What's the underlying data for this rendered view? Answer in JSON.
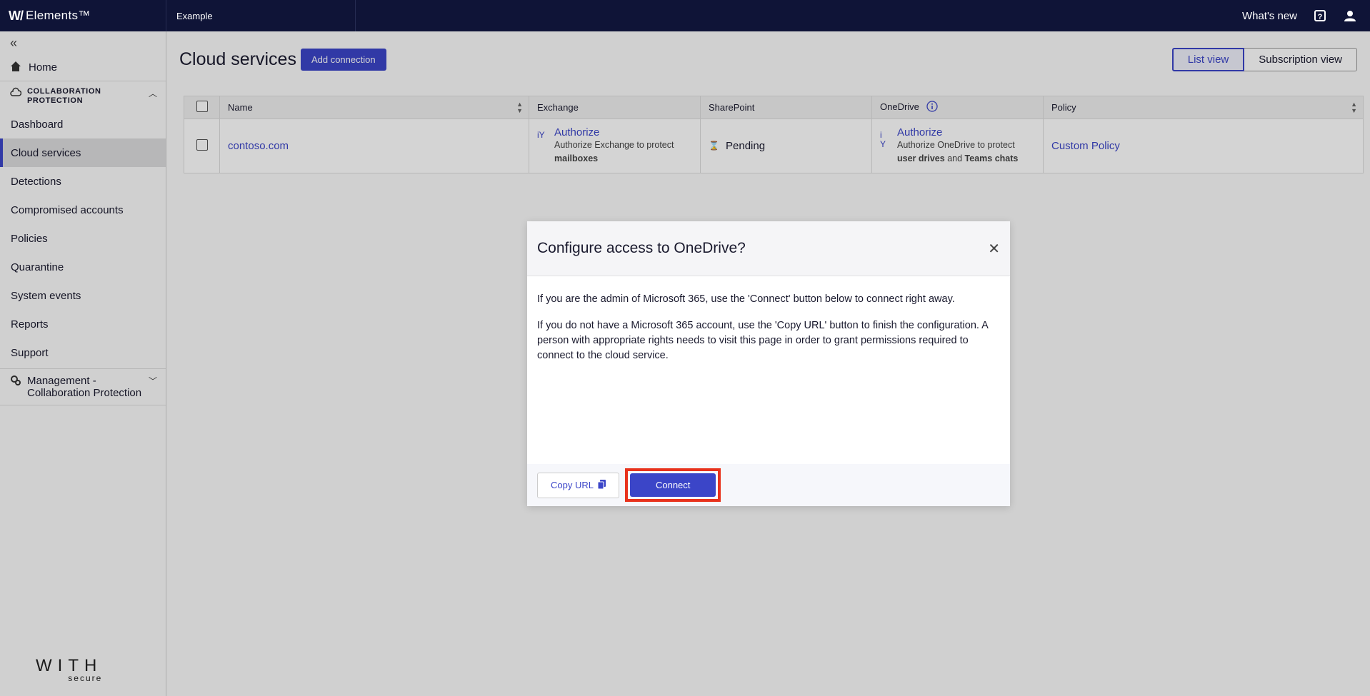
{
  "app": {
    "brand": "Elements™",
    "org": "Example",
    "whats_new": "What's new"
  },
  "sidebar": {
    "home": "Home",
    "group_title": "COLLABORATION PROTECTION",
    "items": [
      {
        "label": "Dashboard"
      },
      {
        "label": "Cloud services"
      },
      {
        "label": "Detections"
      },
      {
        "label": "Compromised accounts"
      },
      {
        "label": "Policies"
      },
      {
        "label": "Quarantine"
      },
      {
        "label": "System events"
      },
      {
        "label": "Reports"
      },
      {
        "label": "Support"
      }
    ],
    "group2_title": "Management - Collaboration Protection",
    "logo_text": "WITH",
    "logo_sub": "secure"
  },
  "page": {
    "title": "Cloud services",
    "add_connection": "Add connection",
    "list_view": "List view",
    "subscription_view": "Subscription view"
  },
  "table": {
    "headers": [
      "Name",
      "Exchange",
      "SharePoint",
      "OneDrive",
      "Policy"
    ],
    "row": {
      "name": "contoso.com",
      "exchange_action": "Authorize",
      "exchange_desc": "Authorize Exchange to protect",
      "exchange_bold": "mailboxes",
      "sharepoint_status": "Pending",
      "onedrive_action": "Authorize",
      "onedrive_desc": "Authorize OneDrive to protect",
      "onedrive_bold1": "user drives",
      "onedrive_and": "and",
      "onedrive_bold2": "Teams chats",
      "policy": "Custom Policy"
    }
  },
  "modal": {
    "title": "Configure access to OneDrive?",
    "para1": "If you are the admin of Microsoft 365, use the 'Connect' button below to connect right away.",
    "para2": "If you do not have a Microsoft 365 account, use the 'Copy URL' button to finish the configuration. A person with appropriate rights needs to visit this page in order to grant permissions required to connect to the cloud service.",
    "copy_url": "Copy URL",
    "connect": "Connect"
  },
  "colors": {
    "accent": "#3b45c8",
    "topbar": "#0f1437",
    "highlight": "#e8321c"
  }
}
